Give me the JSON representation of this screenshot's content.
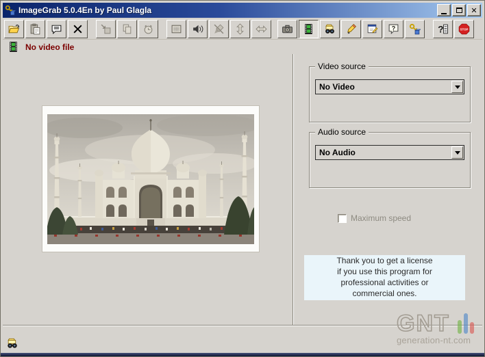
{
  "window": {
    "title": "ImageGrab 5.0.4En by Paul Glagla",
    "app_icon": "key-cube"
  },
  "toolbar": {
    "buttons": [
      {
        "name": "open-file",
        "icon": "folder-open"
      },
      {
        "name": "paste",
        "icon": "paste"
      },
      {
        "name": "comment",
        "icon": "comment"
      },
      {
        "name": "delete",
        "icon": "delete"
      },
      {
        "type": "separator"
      },
      {
        "name": "export-frame",
        "icon": "grab-frame",
        "disabled": true
      },
      {
        "name": "copy",
        "icon": "copy",
        "disabled": true
      },
      {
        "name": "timer",
        "icon": "alarm",
        "disabled": true
      },
      {
        "type": "separator"
      },
      {
        "name": "display",
        "icon": "display"
      },
      {
        "name": "audio",
        "icon": "speaker"
      },
      {
        "name": "draw-off",
        "icon": "brush-off",
        "disabled": true
      },
      {
        "name": "resize-vertical",
        "icon": "arrows-vertical",
        "disabled": true
      },
      {
        "name": "resize-horizontal",
        "icon": "arrows-horizontal",
        "disabled": true
      },
      {
        "type": "gap"
      },
      {
        "name": "snapshot",
        "icon": "camera"
      },
      {
        "name": "video-mode",
        "icon": "filmstrip",
        "pressed": true
      },
      {
        "name": "find",
        "icon": "binoculars"
      },
      {
        "name": "annotate",
        "icon": "hand-pencil"
      },
      {
        "name": "properties",
        "icon": "properties"
      },
      {
        "name": "help",
        "icon": "help"
      },
      {
        "name": "license",
        "icon": "key-cube"
      },
      {
        "type": "separator"
      },
      {
        "name": "video-help",
        "icon": "help-list"
      },
      {
        "name": "stop",
        "icon": "stop",
        "label": "STOP"
      }
    ]
  },
  "status": {
    "text": "No video file",
    "icon": "filmstrip"
  },
  "panel": {
    "video_source": {
      "label": "Video source",
      "value": "No Video"
    },
    "audio_source": {
      "label": "Audio source",
      "value": "No Audio"
    },
    "maximum_speed": {
      "label": "Maximum speed",
      "checked": false
    },
    "license_notice": "Thank you to get a license\nif you use this program for\nprofessional activities or\ncommercial ones."
  },
  "watermark": {
    "logo": "GNT",
    "site": "generation-nt.com",
    "bar_colors": [
      "#6cb33f",
      "#4a86c8",
      "#d9534f"
    ]
  }
}
